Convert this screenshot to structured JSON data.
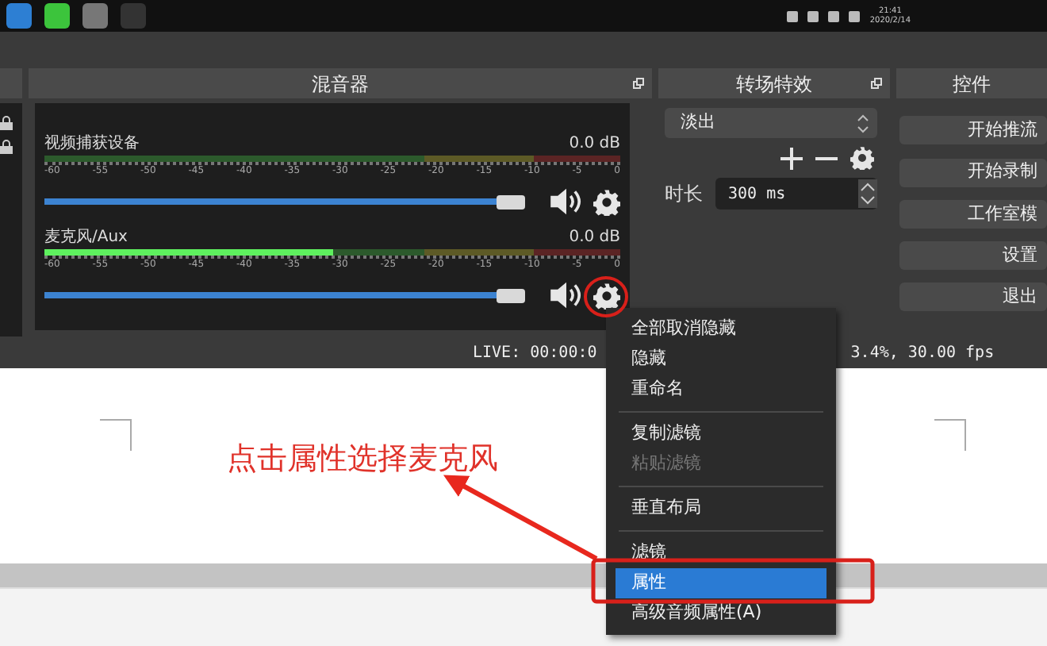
{
  "taskbar": {
    "time": "21:41",
    "date": "2020/2/14"
  },
  "mixer": {
    "title": "混音器",
    "channels": [
      {
        "name": "视频捕获设备",
        "reading": "0.0 dB",
        "meter": {
          "level": 0
        },
        "volume": {
          "level": 0.97
        },
        "scale": [
          "-60",
          "-55",
          "-50",
          "-45",
          "-40",
          "-35",
          "-30",
          "-25",
          "-20",
          "-15",
          "-10",
          "-5",
          "0"
        ]
      },
      {
        "name": "麦克风/Aux",
        "reading": "0.0 dB",
        "meter": {
          "level": 0.5
        },
        "volume": {
          "level": 0.97
        },
        "scale": [
          "-60",
          "-55",
          "-50",
          "-45",
          "-40",
          "-35",
          "-30",
          "-25",
          "-20",
          "-15",
          "-10",
          "-5",
          "0"
        ]
      }
    ]
  },
  "transitions": {
    "title": "转场特效",
    "selected_transition": "淡出",
    "duration_label": "时长",
    "duration": "300 ms"
  },
  "controls": {
    "title": "控件",
    "buttons": [
      "开始推流",
      "开始录制",
      "工作室模",
      "设置",
      "退出"
    ]
  },
  "status_bar": {
    "live": "LIVE: 00:00:0",
    "stats": "3.4%, 30.00 fps"
  },
  "context_menu": {
    "items": [
      {
        "kind": "item",
        "label": "全部取消隐藏",
        "disabled": false,
        "selected": false
      },
      {
        "kind": "item",
        "label": "隐藏",
        "disabled": false,
        "selected": false
      },
      {
        "kind": "item",
        "label": "重命名",
        "disabled": false,
        "selected": false
      },
      {
        "kind": "separator"
      },
      {
        "kind": "item",
        "label": "复制滤镜",
        "disabled": false,
        "selected": false
      },
      {
        "kind": "item",
        "label": "粘贴滤镜",
        "disabled": true,
        "selected": false
      },
      {
        "kind": "separator"
      },
      {
        "kind": "item",
        "label": "垂直布局",
        "disabled": false,
        "selected": false
      },
      {
        "kind": "separator"
      },
      {
        "kind": "item",
        "label": "滤镜",
        "disabled": false,
        "selected": false
      },
      {
        "kind": "item",
        "label": "属性",
        "disabled": false,
        "selected": true
      },
      {
        "kind": "item",
        "label": "高级音频属性(A)",
        "disabled": false,
        "selected": false
      }
    ]
  },
  "annotation": {
    "text": "点击属性选择麦克风"
  }
}
